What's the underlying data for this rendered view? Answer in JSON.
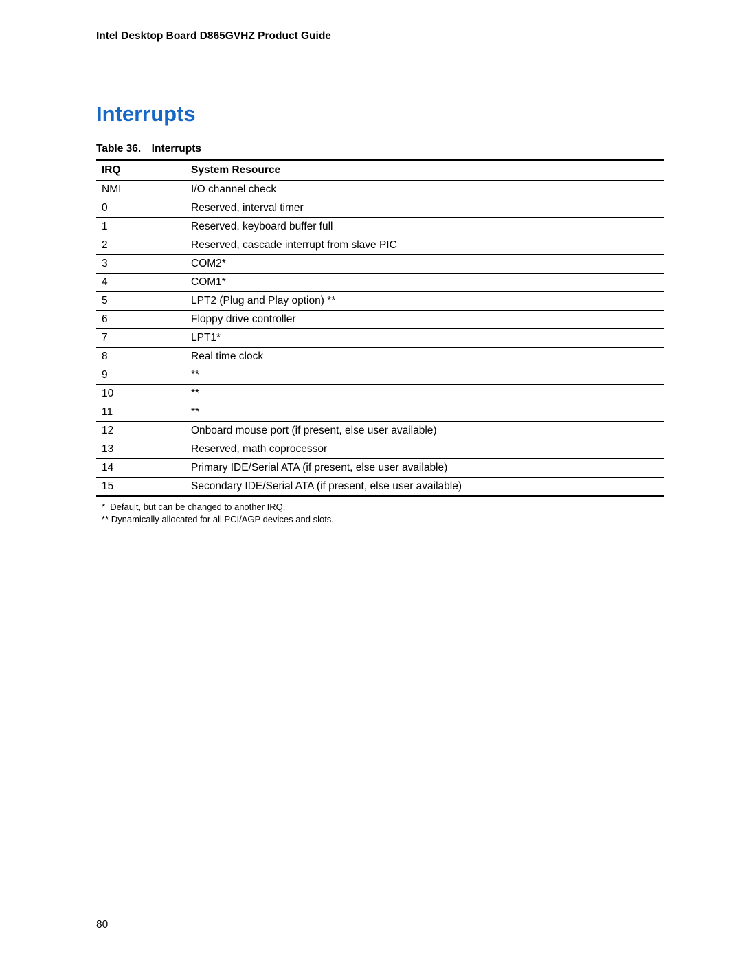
{
  "header": {
    "title": "Intel Desktop Board D865GVHZ Product Guide"
  },
  "section": {
    "heading": "Interrupts"
  },
  "table": {
    "caption": "Table 36. Interrupts",
    "columns": {
      "irq": "IRQ",
      "resource": "System Resource"
    },
    "rows": [
      {
        "irq": "NMI",
        "resource": "I/O channel check"
      },
      {
        "irq": "0",
        "resource": "Reserved, interval timer"
      },
      {
        "irq": "1",
        "resource": "Reserved, keyboard buffer full"
      },
      {
        "irq": "2",
        "resource": "Reserved, cascade interrupt from slave PIC"
      },
      {
        "irq": "3",
        "resource": "COM2*"
      },
      {
        "irq": "4",
        "resource": "COM1*"
      },
      {
        "irq": "5",
        "resource": "LPT2 (Plug and Play option) **"
      },
      {
        "irq": "6",
        "resource": "Floppy drive controller"
      },
      {
        "irq": "7",
        "resource": "LPT1*"
      },
      {
        "irq": "8",
        "resource": "Real time clock"
      },
      {
        "irq": "9",
        "resource": "**"
      },
      {
        "irq": "10",
        "resource": "**"
      },
      {
        "irq": "11",
        "resource": "**"
      },
      {
        "irq": "12",
        "resource": "Onboard mouse port (if present, else user available)"
      },
      {
        "irq": "13",
        "resource": "Reserved, math coprocessor"
      },
      {
        "irq": "14",
        "resource": "Primary IDE/Serial ATA (if present, else user available)"
      },
      {
        "irq": "15",
        "resource": "Secondary IDE/Serial ATA (if present, else user available)"
      }
    ]
  },
  "footnotes": {
    "note1": "*  Default, but can be changed to another IRQ.",
    "note2": "** Dynamically allocated for all PCI/AGP devices and slots."
  },
  "page_number": "80"
}
